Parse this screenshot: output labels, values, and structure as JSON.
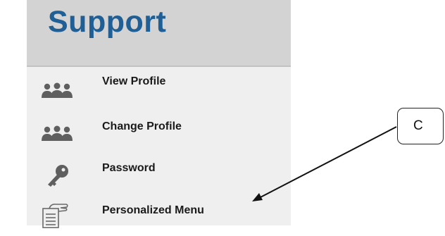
{
  "panel": {
    "title": "Support",
    "items": [
      {
        "label": "View Profile",
        "icon": "users-icon"
      },
      {
        "label": "Change Profile",
        "icon": "users-icon"
      },
      {
        "label": "Password",
        "icon": "key-icon"
      },
      {
        "label": "Personalized Menu",
        "icon": "hand-document-icon"
      }
    ]
  },
  "callout": {
    "text": "C"
  },
  "colors": {
    "title": "#1f5f96",
    "header_bg": "#d3d3d3",
    "panel_bg": "#efefef",
    "icon": "#5f5f5f"
  }
}
